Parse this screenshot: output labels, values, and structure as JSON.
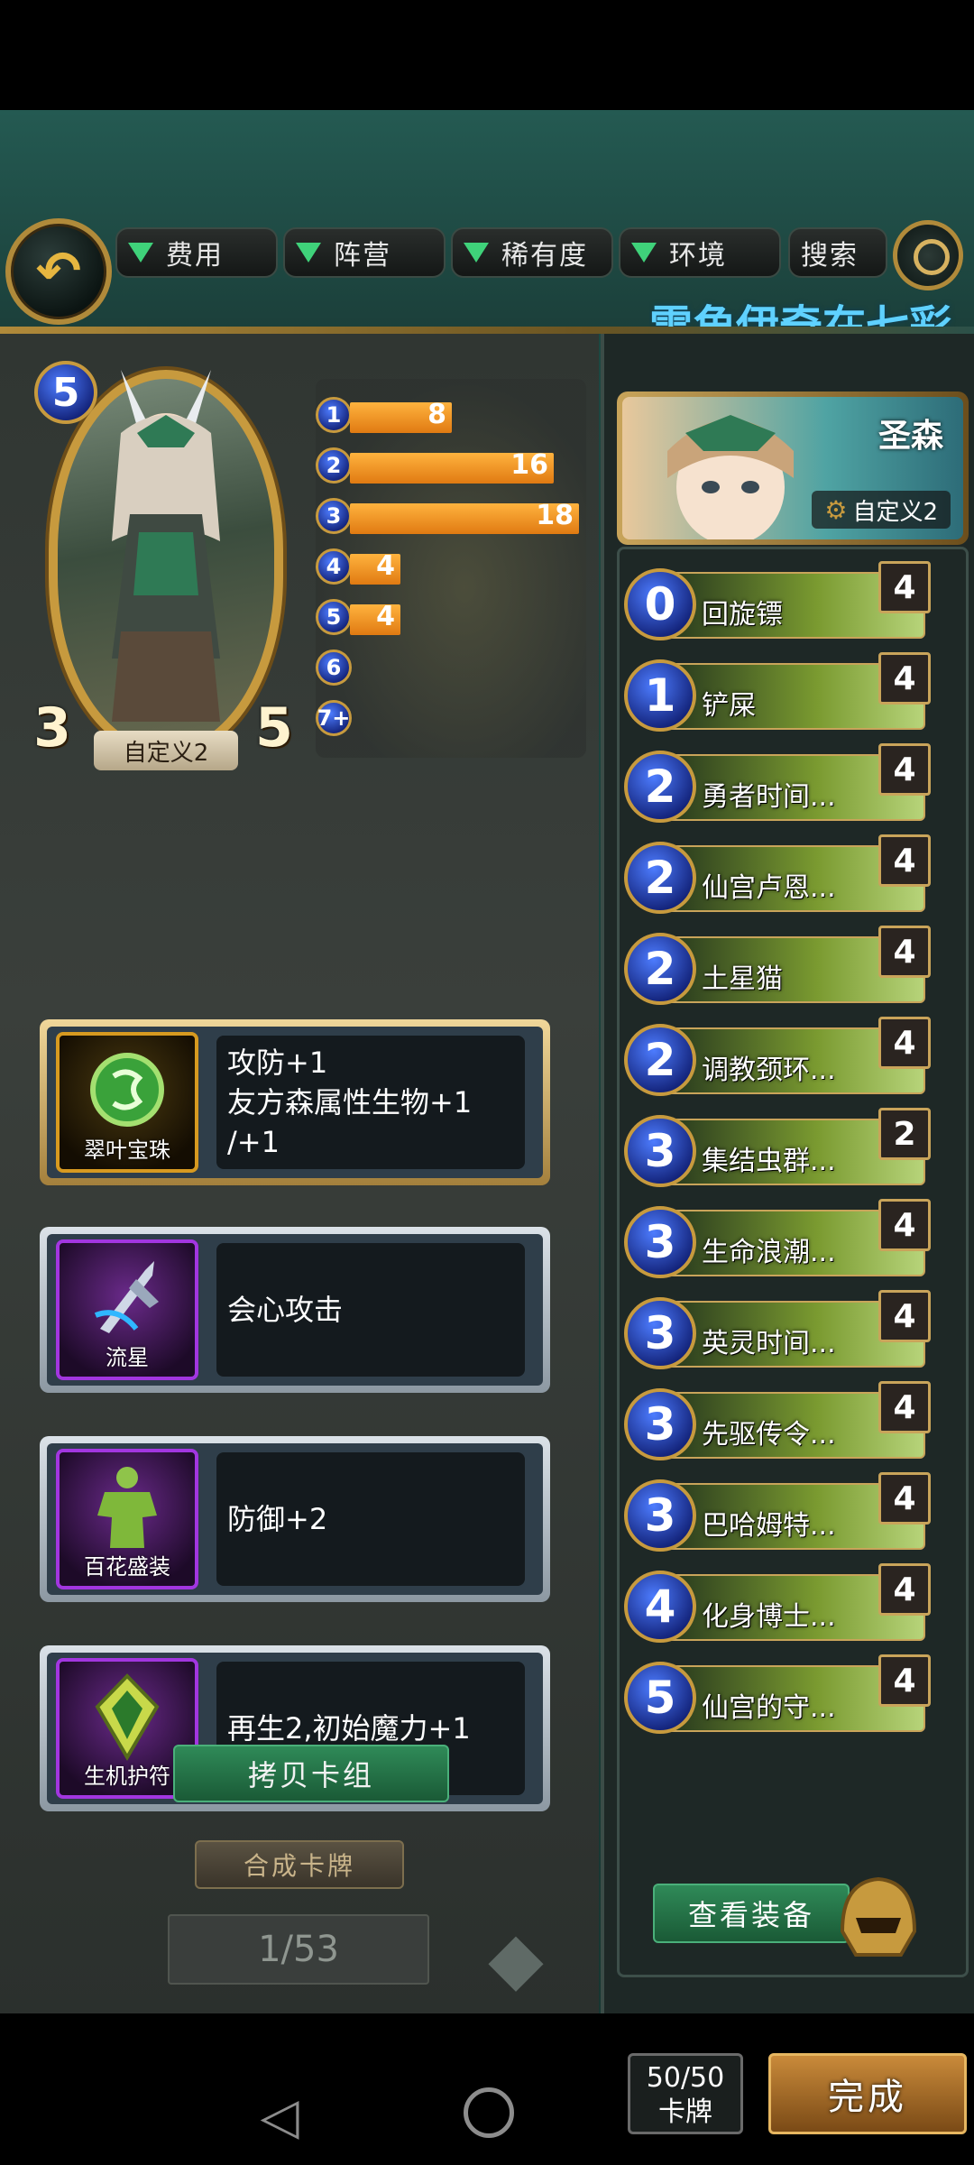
{
  "filters": {
    "cost": "费用",
    "faction": "阵营",
    "rarity": "稀有度",
    "environment": "环境",
    "search": "搜索"
  },
  "deck_title": "雪角伊奇在七彩",
  "character": {
    "name": "自定义2",
    "cost": "5",
    "attack": "3",
    "health": "5"
  },
  "mana_curve": [
    {
      "cost": "1",
      "count": "8",
      "value": 8
    },
    {
      "cost": "2",
      "count": "16",
      "value": 16
    },
    {
      "cost": "3",
      "count": "18",
      "value": 18
    },
    {
      "cost": "4",
      "count": "4",
      "value": 4
    },
    {
      "cost": "5",
      "count": "4",
      "value": 4
    },
    {
      "cost": "6",
      "count": "",
      "value": 0
    },
    {
      "cost": "7+",
      "count": "",
      "value": 0
    }
  ],
  "equipment": [
    {
      "name": "翠叶宝珠",
      "desc_line1": "攻防+1",
      "desc_line2": "友方森属性生物+1",
      "desc_line3": "/+1",
      "icon": "orb-icon"
    },
    {
      "name": "流星",
      "desc_line1": "会心攻击",
      "icon": "spear-icon"
    },
    {
      "name": "百花盛装",
      "desc_line1": "防御+2",
      "icon": "armor-icon"
    },
    {
      "name": "生机护符",
      "desc_line1": "再生2,初始魔力+1",
      "icon": "amulet-icon"
    }
  ],
  "buttons": {
    "copy_deck": "拷贝卡组",
    "synthesize": "合成卡牌",
    "page": "1/53",
    "view_equipment": "查看装备",
    "done": "完成"
  },
  "hero": {
    "name": "圣森",
    "subtitle": "自定义2"
  },
  "cards": [
    {
      "cost": "0",
      "name": "回旋镖",
      "count": "4"
    },
    {
      "cost": "1",
      "name": "铲屎",
      "count": "4"
    },
    {
      "cost": "2",
      "name": "勇者时间...",
      "count": "4"
    },
    {
      "cost": "2",
      "name": "仙宫卢恩...",
      "count": "4"
    },
    {
      "cost": "2",
      "name": "土星猫",
      "count": "4"
    },
    {
      "cost": "2",
      "name": "调教颈环...",
      "count": "4"
    },
    {
      "cost": "3",
      "name": "集结虫群...",
      "count": "2"
    },
    {
      "cost": "3",
      "name": "生命浪潮...",
      "count": "4"
    },
    {
      "cost": "3",
      "name": "英灵时间...",
      "count": "4"
    },
    {
      "cost": "3",
      "name": "先驱传令...",
      "count": "4"
    },
    {
      "cost": "3",
      "name": "巴哈姆特...",
      "count": "4"
    },
    {
      "cost": "4",
      "name": "化身博士...",
      "count": "4"
    },
    {
      "cost": "5",
      "name": "仙宫的守...",
      "count": "4"
    }
  ],
  "deck_count": {
    "line1": "50/50",
    "line2": "卡牌"
  },
  "colors": {
    "accent_gold": "#c79a3e",
    "bar_orange": "#f29a2a",
    "button_green": "#2f8a58",
    "cost_blue": "#2a4bd6"
  }
}
